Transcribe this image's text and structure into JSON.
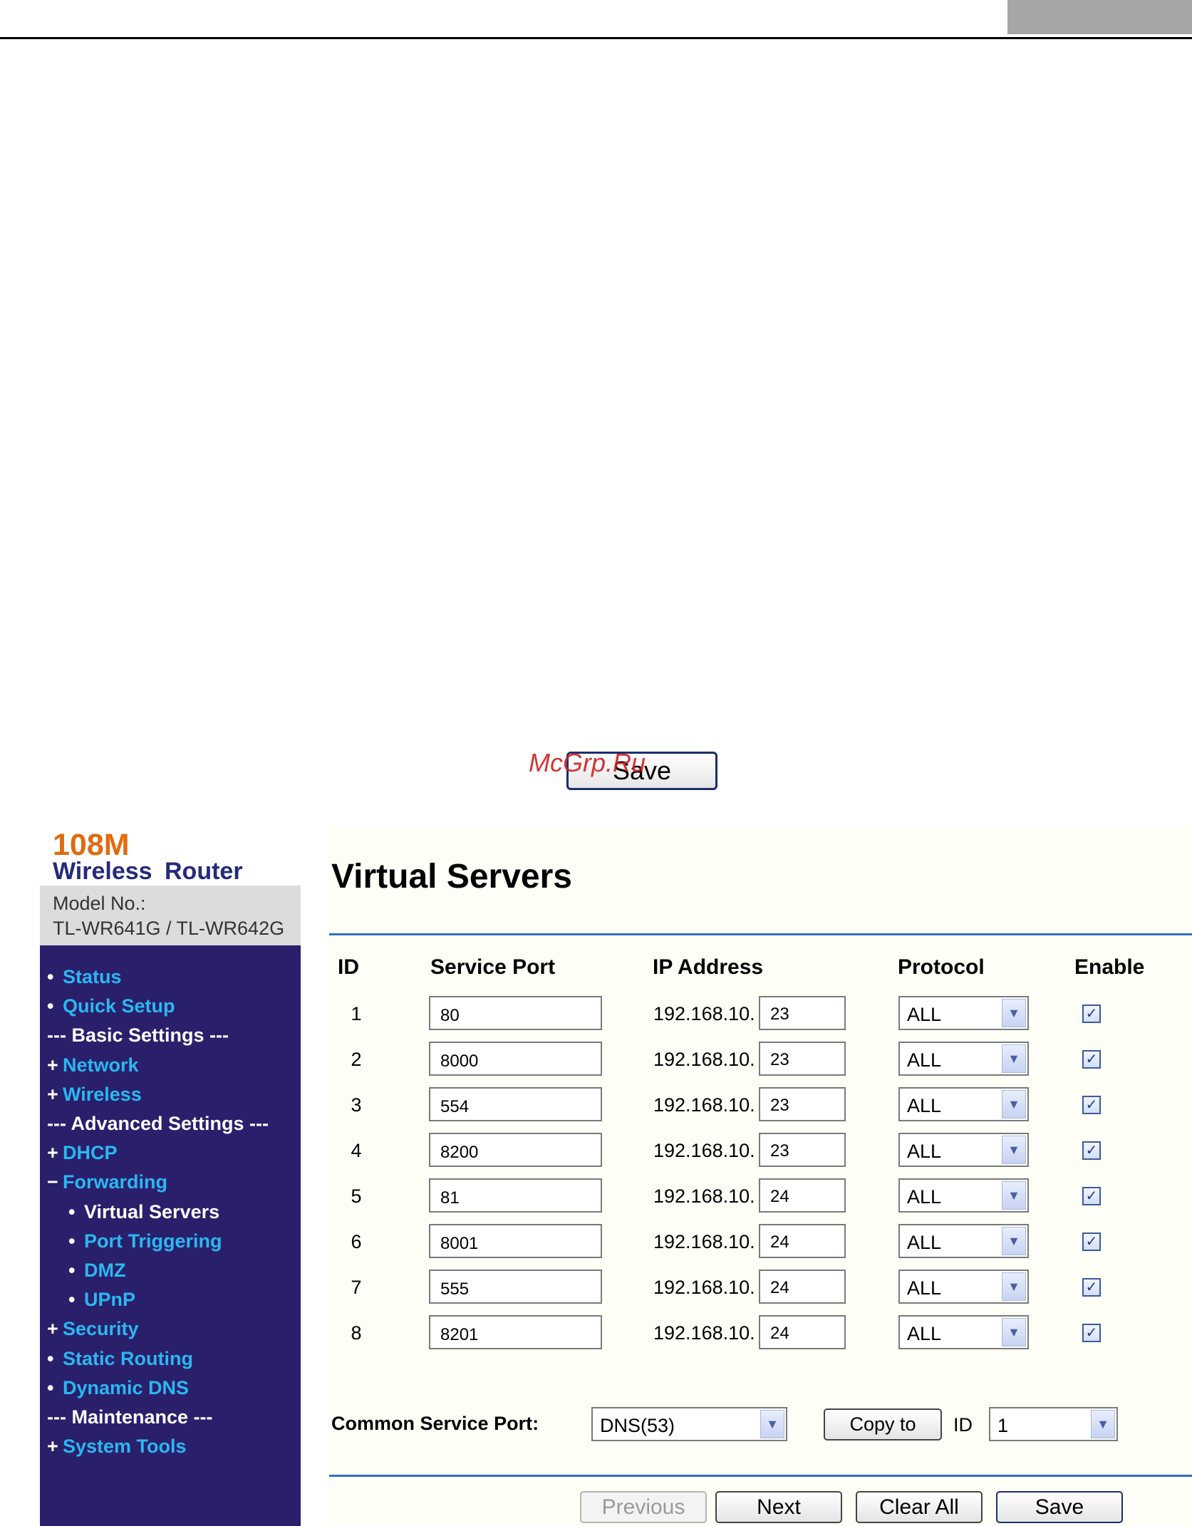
{
  "top_save_label": "Save",
  "watermark": "McGrp.Ru",
  "brand": {
    "line1": "108M",
    "line2": "Wireless  Router",
    "model_label": "Model No.:",
    "model_value": "TL-WR641G / TL-WR642G"
  },
  "sidebar": {
    "items": [
      {
        "label": "Status",
        "kind": "link",
        "bullet": "•"
      },
      {
        "label": "Quick Setup",
        "kind": "link",
        "bullet": "•"
      },
      {
        "label": "--- Basic Settings ---",
        "kind": "head",
        "bullet": ""
      },
      {
        "label": "Network",
        "kind": "link",
        "bullet": "+"
      },
      {
        "label": "Wireless",
        "kind": "link",
        "bullet": "+"
      },
      {
        "label": "--- Advanced Settings ---",
        "kind": "head",
        "bullet": ""
      },
      {
        "label": "DHCP",
        "kind": "link",
        "bullet": "+"
      },
      {
        "label": "Forwarding",
        "kind": "link",
        "bullet": "−"
      },
      {
        "label": "Virtual Servers",
        "kind": "sub-active",
        "bullet": "•"
      },
      {
        "label": "Port Triggering",
        "kind": "sub",
        "bullet": "•"
      },
      {
        "label": "DMZ",
        "kind": "sub",
        "bullet": "•"
      },
      {
        "label": "UPnP",
        "kind": "sub",
        "bullet": "•"
      },
      {
        "label": "Security",
        "kind": "link",
        "bullet": "+"
      },
      {
        "label": "Static Routing",
        "kind": "link",
        "bullet": "•"
      },
      {
        "label": "Dynamic DNS",
        "kind": "link",
        "bullet": "•"
      },
      {
        "label": "--- Maintenance ---",
        "kind": "head",
        "bullet": ""
      },
      {
        "label": "System Tools",
        "kind": "link",
        "bullet": "+"
      }
    ]
  },
  "main": {
    "title": "Virtual Servers",
    "columns": {
      "id": "ID",
      "service_port": "Service Port",
      "ip_address": "IP Address",
      "protocol": "Protocol",
      "enable": "Enable"
    },
    "ip_prefix": "192.168.10.",
    "rows": [
      {
        "id": "1",
        "port": "80",
        "host": "23",
        "protocol": "ALL",
        "enabled": true
      },
      {
        "id": "2",
        "port": "8000",
        "host": "23",
        "protocol": "ALL",
        "enabled": true
      },
      {
        "id": "3",
        "port": "554",
        "host": "23",
        "protocol": "ALL",
        "enabled": true
      },
      {
        "id": "4",
        "port": "8200",
        "host": "23",
        "protocol": "ALL",
        "enabled": true
      },
      {
        "id": "5",
        "port": "81",
        "host": "24",
        "protocol": "ALL",
        "enabled": true
      },
      {
        "id": "6",
        "port": "8001",
        "host": "24",
        "protocol": "ALL",
        "enabled": true
      },
      {
        "id": "7",
        "port": "555",
        "host": "24",
        "protocol": "ALL",
        "enabled": true
      },
      {
        "id": "8",
        "port": "8201",
        "host": "24",
        "protocol": "ALL",
        "enabled": true
      }
    ],
    "common_service_port": {
      "label": "Common Service Port:",
      "selected": "DNS(53)",
      "copy_label": "Copy to",
      "id_label": "ID",
      "id_selected": "1"
    },
    "buttons": {
      "previous": "Previous",
      "next": "Next",
      "clear_all": "Clear All",
      "save": "Save"
    }
  },
  "icons": {
    "dropdown": "chevron-down-icon",
    "checkbox": "checkmark-icon"
  },
  "colors": {
    "sidebar_bg": "#2a1f6b",
    "link": "#2ab8f0",
    "brand_orange": "#e06b10",
    "rule_blue": "#2f72b8"
  }
}
